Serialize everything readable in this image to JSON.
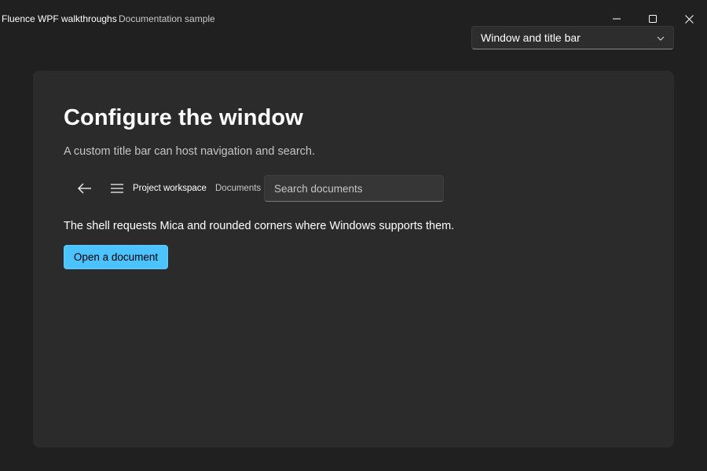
{
  "window": {
    "title": "Fluence WPF walkthroughs",
    "subtitle": "Documentation sample",
    "controls": {
      "minimize_icon": "minimize-icon",
      "maximize_icon": "maximize-icon",
      "close_icon": "close-icon"
    }
  },
  "page_selector": {
    "selected": "Window and title bar",
    "icon": "chevron-down-icon"
  },
  "content": {
    "heading": "Configure the window",
    "subheading": "A custom title bar can host navigation and search.",
    "demo_titlebar": {
      "back_icon": "back-arrow-icon",
      "menu_icon": "hamburger-menu-icon",
      "title": "Project workspace",
      "subtitle": "Documents",
      "search_placeholder": "Search documents"
    },
    "description": "The shell requests Mica and rounded corners where Windows supports them.",
    "primary_button": "Open a document"
  },
  "colors": {
    "background": "#202020",
    "card": "#2b2b2b",
    "accent": "#4cc2ff",
    "text_secondary": "#c5c5c5"
  }
}
